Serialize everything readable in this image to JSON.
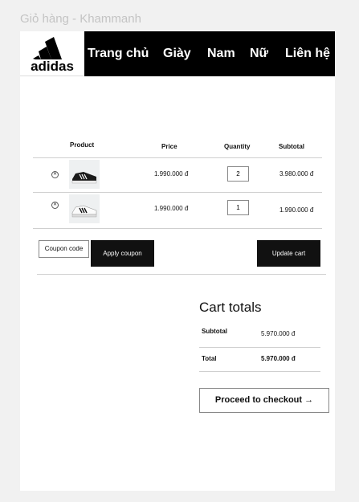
{
  "frame_title": "Giỏ hàng - Khammanh",
  "brand": {
    "logo_text": "adidas",
    "icon": "adidas-logo-icon"
  },
  "nav": {
    "items": [
      {
        "label": "Trang chủ"
      },
      {
        "label": "Giày"
      },
      {
        "label": "Nam"
      },
      {
        "label": "Nữ"
      },
      {
        "label": "Liên hệ"
      }
    ]
  },
  "cart": {
    "headers": {
      "product": "Product",
      "price": "Price",
      "quantity": "Quantity",
      "subtotal": "Subtotal"
    },
    "rows": [
      {
        "remove_icon": "remove-x-icon",
        "image": "black-sneaker-image",
        "price": "1.990.000 đ",
        "quantity": "2",
        "subtotal": "3.980.000 đ"
      },
      {
        "remove_icon": "remove-x-icon",
        "image": "white-sneaker-image",
        "price": "1.990.000 đ",
        "quantity": "1",
        "subtotal": "1.990.000 đ"
      }
    ],
    "coupon_placeholder": "Coupon code",
    "apply_coupon_label": "Apply coupon",
    "update_cart_label": "Update cart"
  },
  "totals": {
    "title": "Cart totals",
    "subtotal_label": "Subtotal",
    "subtotal_value": "5.970.000 đ",
    "total_label": "Total",
    "total_value": "5.970.000 đ",
    "checkout_label": "Proceed to checkout →"
  },
  "colors": {
    "nav_bg": "#000000",
    "button_bg": "#111111",
    "page_bg": "#f1f1f1"
  }
}
